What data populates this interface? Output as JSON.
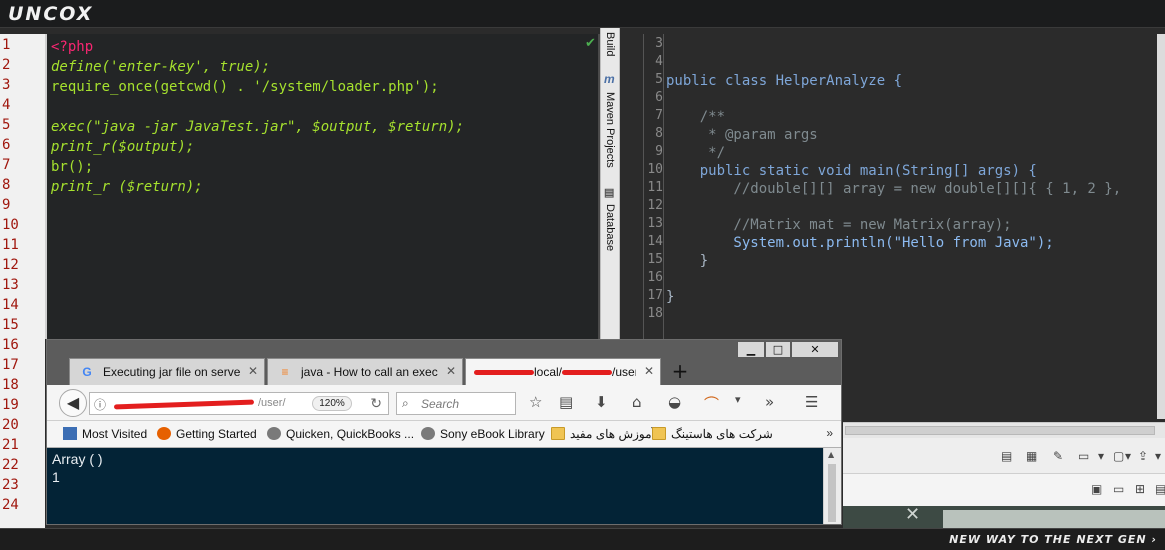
{
  "brand": {
    "logo": "UNCOX",
    "tagline": "NEW WAY TO THE NEXT GEN ›"
  },
  "left_editor": {
    "line_numbers": [
      "1",
      "2",
      "3",
      "4",
      "5",
      "6",
      "7",
      "8",
      "9",
      "10",
      "11",
      "12",
      "13",
      "14",
      "15",
      "16",
      "17",
      "18",
      "19",
      "20",
      "21",
      "22",
      "23",
      "24"
    ],
    "lines": [
      "<?php",
      "define('enter-key', true);",
      "require_once(getcwd() . '/system/loader.php');",
      "",
      "exec(\"java -jar JavaTest.jar\", $output, $return);",
      "print_r($output);",
      "br();",
      "print_r ($return);"
    ]
  },
  "tool_tabs": {
    "build": "Build",
    "maven": "Maven Projects",
    "maven_icon": "m",
    "database": "Database"
  },
  "right_editor": {
    "line_numbers": [
      "3",
      "4",
      "5",
      "6",
      "7",
      "8",
      "9",
      "10",
      "11",
      "12",
      "13",
      "14",
      "15",
      "16",
      "17",
      "18"
    ],
    "lines": [
      "",
      "",
      "public class HelperAnalyze {",
      "",
      "    /**",
      "     * @param args",
      "     */",
      "    public static void main(String[] args) {",
      "        //double[][] array = new double[][]{ { 1, 2 },",
      "",
      "        //Matrix mat = new Matrix(array);",
      "        System.out.println(\"Hello from Java\");",
      "    }",
      "",
      "}",
      ""
    ]
  },
  "browser": {
    "window_controls": {
      "minimize": "▁",
      "maximize": "□",
      "close": "✕"
    },
    "tabs": [
      {
        "label": "Executing jar file on server",
        "icon": "google-icon",
        "active": false
      },
      {
        "label": "java - How to call an execu",
        "icon": "stackoverflow-icon",
        "active": false
      },
      {
        "label": "local/",
        "label_suffix": "/user",
        "icon": "redacted-icon",
        "active": true
      }
    ],
    "new_tab": "+",
    "url": {
      "text": "/user/",
      "zoom": "120%"
    },
    "search": {
      "placeholder": "Search"
    },
    "bookmarks": [
      {
        "label": "Most Visited",
        "icon": "most-visited-icon"
      },
      {
        "label": "Getting Started",
        "icon": "firefox-icon"
      },
      {
        "label": "Quicken, QuickBooks ...",
        "icon": "globe-icon"
      },
      {
        "label": "Sony eBook Library",
        "icon": "globe-icon"
      },
      {
        "label": "آموزش های مفید",
        "icon": "folder-icon"
      },
      {
        "label": "شرکت های هاستینگ",
        "icon": "folder-icon"
      }
    ],
    "bookmarks_more": "»",
    "page_output": [
      "Array ( )",
      "1"
    ]
  },
  "colors": {
    "left_editor_bg": "#232526",
    "right_editor_bg": "#2b2b2b",
    "browser_content_bg": "#032336",
    "line_number_color": "#a0170e"
  }
}
